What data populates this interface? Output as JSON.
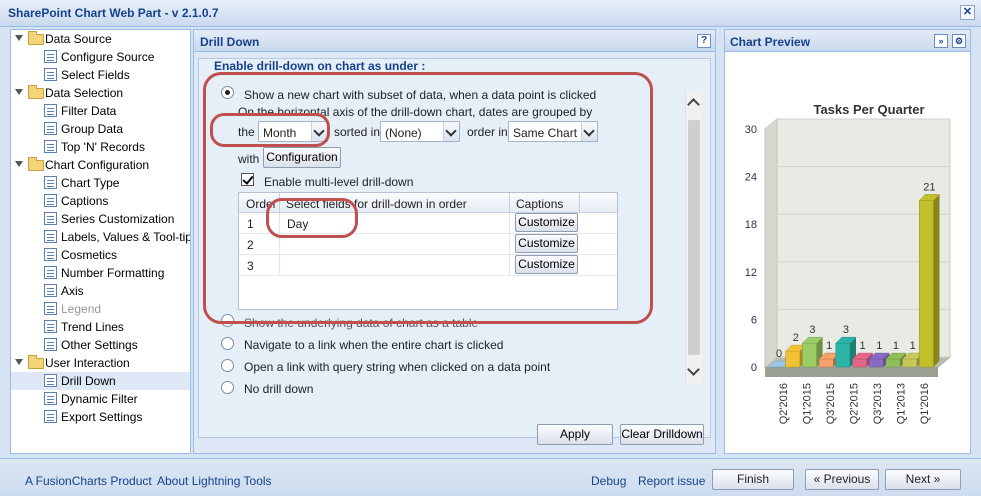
{
  "window": {
    "title": "SharePoint Chart Web Part - v 2.1.0.7",
    "close_label": "✕"
  },
  "tree": {
    "groups": [
      {
        "label": "Data Source",
        "items": [
          "Configure Source",
          "Select Fields"
        ]
      },
      {
        "label": "Data Selection",
        "items": [
          "Filter Data",
          "Group Data",
          "Top 'N' Records"
        ]
      },
      {
        "label": "Chart Configuration",
        "items": [
          "Chart Type",
          "Captions",
          "Series Customization",
          "Labels, Values & Tool-tips",
          "Cosmetics",
          "Number Formatting",
          "Axis",
          "Legend",
          "Trend Lines",
          "Other Settings"
        ]
      },
      {
        "label": "User Interaction",
        "items": [
          "Drill Down",
          "Dynamic Filter",
          "Export Settings"
        ]
      }
    ],
    "selected": "Drill Down",
    "disabled": [
      "Legend"
    ]
  },
  "drill": {
    "panel_title": "Drill Down",
    "help_label": "?",
    "legend": "Enable drill-down on chart as under :",
    "option_new_chart": "Show a new chart with subset of data, when a data point is clicked",
    "option_new_chart_sub": "On the horizontal axis of the drill-down chart, dates are grouped by",
    "the_label": "the",
    "group_by_value": "Month",
    "sorted_in_label": "sorted in",
    "sorted_value": "(None)",
    "order_in_label": "order in",
    "order_value": "Same Chart",
    "with_label": "with",
    "configuration_button": "Configuration",
    "multilevel_label": "Enable multi-level drill-down",
    "grid": {
      "headers": [
        "Order",
        "Select fields for drill-down in order",
        "Captions"
      ],
      "rows": [
        {
          "order": "1",
          "field": "Day",
          "button": "Customize"
        },
        {
          "order": "2",
          "field": "",
          "button": "Customize"
        },
        {
          "order": "3",
          "field": "",
          "button": "Customize"
        }
      ]
    },
    "option_table": "Show the underlying data of chart as a table",
    "option_link": "Navigate to a link when the entire chart is clicked",
    "option_query": "Open a link with query string when clicked on a data point",
    "option_none": "No drill down",
    "apply_button": "Apply",
    "clear_button": "Clear Drilldown"
  },
  "preview": {
    "panel_title": "Chart Preview",
    "expand_label": "»",
    "settings_label": "⚙"
  },
  "chart_data": {
    "type": "bar",
    "title": "Tasks Per Quarter",
    "categories": [
      "Q2'2016",
      "Q1'2015",
      "Q3'2015",
      "Q2'2015",
      "Q3'2013",
      "Q1'2013",
      "Q1'2016"
    ],
    "values": [
      0,
      2,
      3,
      1,
      3,
      1,
      1,
      1,
      1,
      21
    ],
    "bar_labels": [
      "0",
      "2",
      "3",
      "1",
      "3",
      "1",
      "1",
      "1",
      "1",
      "21"
    ],
    "bar_colors": [
      "#9fc5e8",
      "#f1c232",
      "#9ccc65",
      "#f6a06a",
      "#2bb5a6",
      "#e2668a",
      "#8a6bc4",
      "#8fbf5a",
      "#c8c85a",
      "#c2c02a"
    ],
    "ylim": [
      0,
      30
    ],
    "yticks": [
      0,
      6,
      12,
      18,
      24,
      30
    ]
  },
  "footer": {
    "fusion_link": "A FusionCharts Product",
    "about_link": "About Lightning Tools",
    "debug_link": "Debug",
    "report_link": "Report issue",
    "finish_button": "Finish",
    "previous_button": "« Previous",
    "next_button": "Next »"
  }
}
